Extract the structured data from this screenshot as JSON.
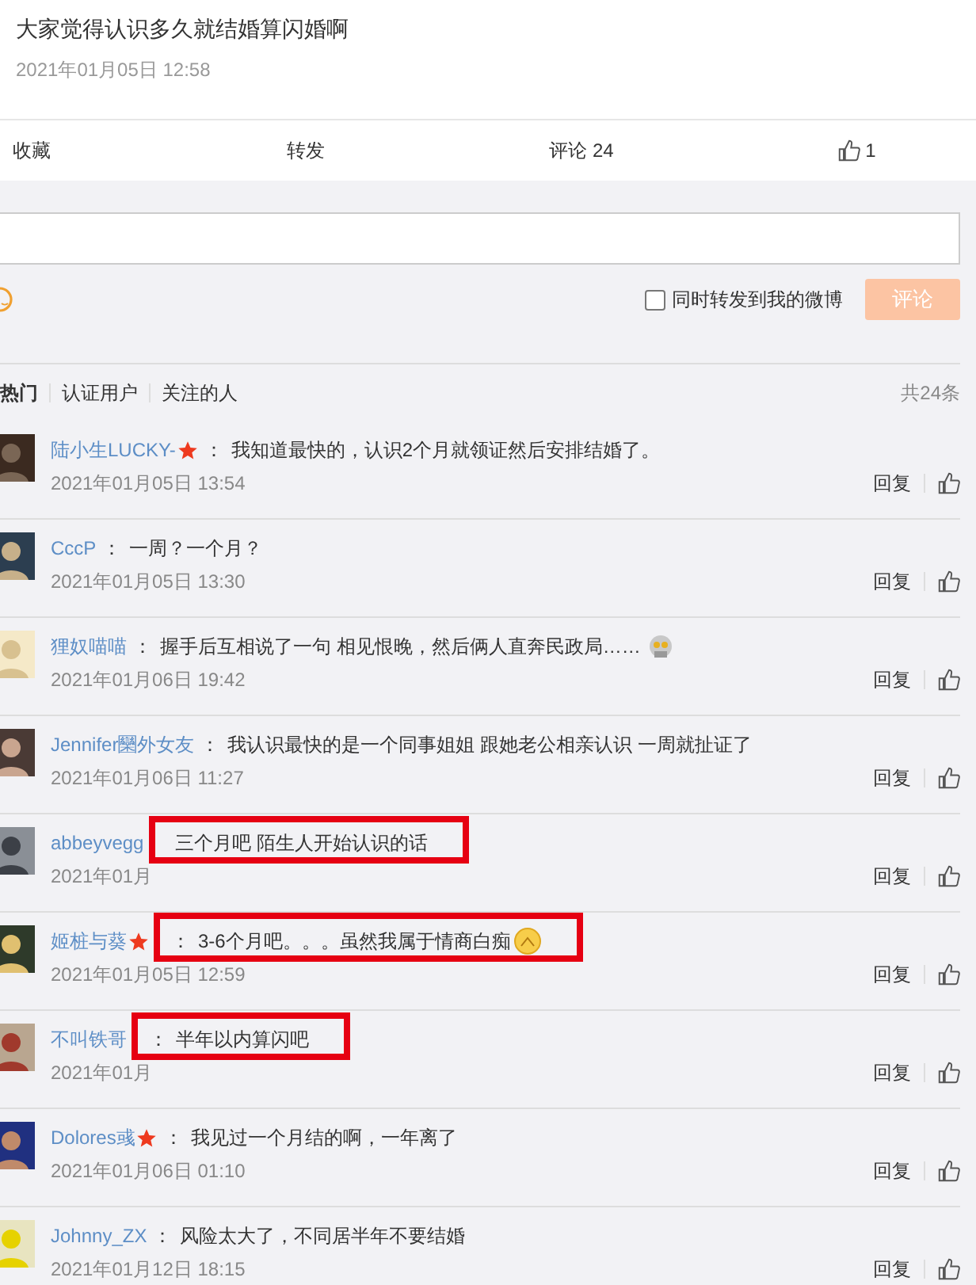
{
  "post": {
    "text": "大家觉得认识多久就结婚算闪婚啊",
    "time": "2021年01月05日 12:58"
  },
  "actions": [
    {
      "kind": "text",
      "label": "收藏"
    },
    {
      "kind": "text",
      "label": "转发"
    },
    {
      "kind": "text",
      "label": "评论 24"
    },
    {
      "kind": "like",
      "label": "1"
    }
  ],
  "composer": {
    "forward_label": "同时转发到我的微博",
    "forward_checked": false,
    "submit": "评论"
  },
  "filters": [
    {
      "label": "热门",
      "selected": true
    },
    {
      "label": "认证用户",
      "selected": false
    },
    {
      "label": "关注的人",
      "selected": false
    }
  ],
  "total": "共24条",
  "comments": [
    {
      "name": "陆小生LUCKY-",
      "verified": true,
      "separator": "：",
      "text": "我知道最快的，认识2个月就领证然后安排结婚了。",
      "time": "2021年01月05日 13:54",
      "reply": "回复",
      "highlighted": false
    },
    {
      "name": "CccP",
      "verified": false,
      "separator": "：",
      "text": "一周？一个月？",
      "time": "2021年01月05日 13:30",
      "reply": "回复",
      "highlighted": false
    },
    {
      "name": "狸奴喵喵",
      "verified": false,
      "separator": "：",
      "text": "握手后互相说了一句 相见恨晚，然后俩人直奔民政局……",
      "emoticon": {
        "kind": "robot"
      },
      "time": "2021年01月06日 19:42",
      "reply": "回复",
      "highlighted": false
    },
    {
      "name": "Jennifer圞外女友",
      "verified": false,
      "separator": "：",
      "text": "我认识最快的是一个同事姐姐 跟她老公相亲认识 一周就扯证了",
      "time": "2021年01月06日 11:27",
      "reply": "回复",
      "highlighted": false
    },
    {
      "name": "abbeyvegg",
      "verified": false,
      "text": "三个月吧 陌生人开始认识的话",
      "time": "2021年01月",
      "reply": "回复",
      "highlighted": true
    },
    {
      "name": "姬桩与葵",
      "verified": true,
      "separator": "：",
      "text": "3-6个月吧。。。虽然我属于情商白痴",
      "emoticon": {
        "kind": "face"
      },
      "time": "2021年01月05日 12:59",
      "reply": "回复",
      "highlighted": true
    },
    {
      "name": "不叫铁哥",
      "verified": false,
      "separator": "：",
      "text": "半年以内算闪吧",
      "time": "2021年01月",
      "reply": "回复",
      "highlighted": true
    },
    {
      "name": "Dolores彧",
      "verified": true,
      "separator": "：",
      "text": "我见过一个月结的啊，一年离了",
      "time": "2021年01月06日 01:10",
      "reply": "回复",
      "highlighted": false
    },
    {
      "name": "Johnny_ZX",
      "verified": false,
      "separator": "：",
      "text": "风险太大了，不同居半年不要结婚",
      "time": "2021年01月12日 18:15",
      "reply": "回复",
      "highlighted": false
    }
  ]
}
